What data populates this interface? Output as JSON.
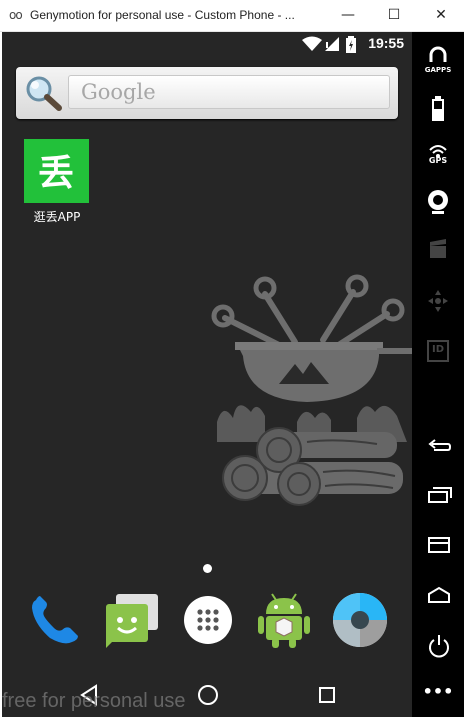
{
  "window": {
    "app_icon": "oo",
    "title": "Genymotion for personal use - Custom Phone - ...",
    "minimize_symbol": "—",
    "maximize_symbol": "☐",
    "close_symbol": "✕"
  },
  "statusbar": {
    "time": "19:55",
    "icons": [
      "wifi-icon",
      "cell-signal-icon",
      "battery-icon"
    ]
  },
  "search": {
    "placeholder": "Google",
    "icon": "magnifier-icon"
  },
  "home": {
    "app_label": "逛丢APP",
    "app_glyph": "丢",
    "page_indicator": {
      "pages": 1,
      "current": 1
    }
  },
  "dock": [
    {
      "name": "phone-icon"
    },
    {
      "name": "messaging-icon"
    },
    {
      "name": "app-drawer-icon"
    },
    {
      "name": "android-installer-icon"
    },
    {
      "name": "camera-icon"
    }
  ],
  "navbar": [
    "back-icon",
    "home-icon",
    "recents-icon"
  ],
  "watermark": "free for personal use",
  "sidebar": {
    "items": [
      {
        "icon": "gapps-icon",
        "label": "GAPPS"
      },
      {
        "icon": "battery-widget-icon",
        "label": ""
      },
      {
        "icon": "gps-icon",
        "label": "GPS"
      },
      {
        "icon": "webcam-icon",
        "label": ""
      },
      {
        "icon": "media-icon",
        "label": ""
      },
      {
        "icon": "dpad-icon",
        "label": ""
      },
      {
        "icon": "device-id-icon",
        "label": "ID"
      },
      {
        "icon": "back-icon",
        "label": ""
      },
      {
        "icon": "recent-apps-icon",
        "label": ""
      },
      {
        "icon": "menu-icon",
        "label": ""
      },
      {
        "icon": "home-icon",
        "label": ""
      },
      {
        "icon": "power-icon",
        "label": ""
      },
      {
        "icon": "more-icon",
        "label": "•••"
      }
    ]
  },
  "colors": {
    "screen_bg": "#262626",
    "app_tile": "#22c13a",
    "sidebar_bg": "#000000",
    "dock_phone": "#1e88e5",
    "dock_android": "#8bc34a",
    "dock_camera": "#29b6f6"
  }
}
